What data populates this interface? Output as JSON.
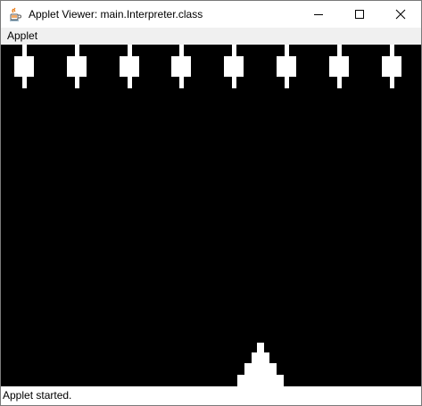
{
  "window": {
    "title": "Applet Viewer: main.Interpreter.class",
    "icon": "java-coffee-cup-icon",
    "minimize_icon": "minimize-icon",
    "maximize_icon": "maximize-icon",
    "close_icon": "close-icon"
  },
  "menubar": {
    "items": [
      {
        "label": "Applet"
      }
    ]
  },
  "game": {
    "background": "#000000",
    "sprite_color": "#ffffff",
    "enemy_count": 8,
    "enemy_icon": "invader-sprite",
    "player_icon": "player-ship-sprite"
  },
  "status": {
    "text": "Applet started."
  }
}
